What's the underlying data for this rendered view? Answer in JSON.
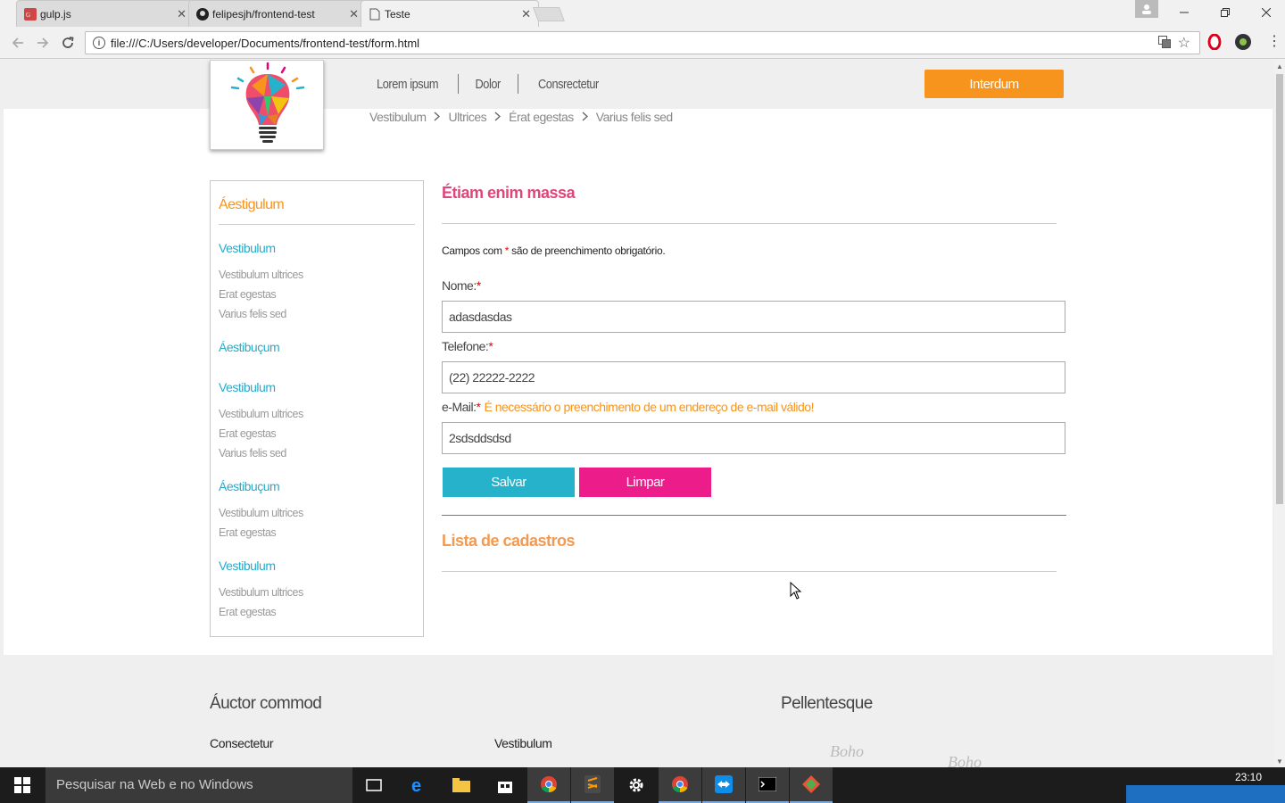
{
  "browser": {
    "tabs": [
      {
        "title": "gulp.js",
        "favicon": "gulp-icon"
      },
      {
        "title": "felipesjh/frontend-test",
        "favicon": "github-icon"
      },
      {
        "title": "Teste",
        "favicon": "document-icon"
      }
    ],
    "close_glyph": "✕",
    "url": "file:///C:/Users/developer/Documents/frontend-test/form.html"
  },
  "site": {
    "nav": [
      "Lorem ipsum",
      "Dolor",
      "Consrectetur"
    ],
    "cta_label": "Interdum",
    "breadcrumb": [
      "Vestibulum",
      "Ultrices",
      "Érat egestas",
      "Varius felis sed"
    ],
    "sidebar": {
      "title": "Áestigulum",
      "items": [
        {
          "type": "head",
          "label": "Vestibulum"
        },
        {
          "type": "sub",
          "label": "Vestibulum ultrices"
        },
        {
          "type": "sub",
          "label": "Erat egestas"
        },
        {
          "type": "sub",
          "label": "Varius felis sed"
        },
        {
          "type": "head",
          "label": "Áestibuçum"
        },
        {
          "type": "head",
          "label": "Vestibulum"
        },
        {
          "type": "sub",
          "label": "Vestibulum ultrices"
        },
        {
          "type": "sub",
          "label": "Erat egestas"
        },
        {
          "type": "sub",
          "label": "Varius felis sed"
        },
        {
          "type": "head",
          "label": "Áestibuçum"
        },
        {
          "type": "sub",
          "label": "Vestibulum ultrices"
        },
        {
          "type": "sub",
          "label": "Erat egestas"
        },
        {
          "type": "head",
          "label": "Vestibulum"
        },
        {
          "type": "sub",
          "label": "Vestibulum ultrices"
        },
        {
          "type": "sub",
          "label": "Erat egestas"
        }
      ]
    },
    "form": {
      "title": "Étiam enim massa",
      "required_note_prefix": "Campos com ",
      "required_note_star": "*",
      "required_note_suffix": " são de preenchimento obrigatório.",
      "name_label": "Nome:",
      "name_value": "adasdasdas",
      "phone_label": "Telefone:",
      "phone_value": "(22) 22222-2222",
      "email_label": "e-Mail:",
      "email_error": "É necessário o preenchimento de um endereço de e-mail válido!",
      "email_value": "2sdsddsdsd",
      "star": "*",
      "save_label": "Salvar",
      "clear_label": "Limpar"
    },
    "list_title": "Lista de cadastros",
    "footer": {
      "col1_title": "Áuctor commod",
      "col1_sub": "Consectetur",
      "col2_sub": "Vestibulum",
      "col3_title": "Pellentesque",
      "brand_1": "Boho",
      "brand_2": "Boho"
    }
  },
  "taskbar": {
    "search_placeholder": "Pesquisar na Web e no Windows",
    "time": "23:10"
  },
  "colors": {
    "orange": "#f7941d",
    "teal": "#27b2cb",
    "pink": "#ec1c8a"
  }
}
